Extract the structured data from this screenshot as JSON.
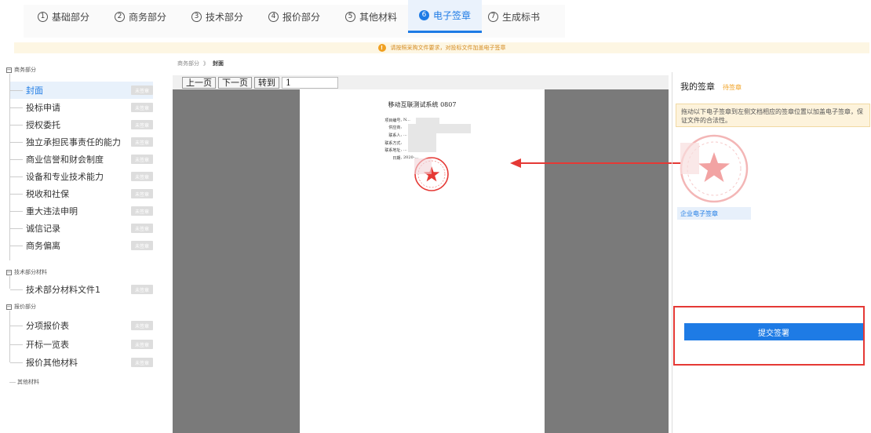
{
  "tabs": [
    {
      "num": "1",
      "label": "基础部分"
    },
    {
      "num": "2",
      "label": "商务部分"
    },
    {
      "num": "3",
      "label": "技术部分"
    },
    {
      "num": "4",
      "label": "报价部分"
    },
    {
      "num": "5",
      "label": "其他材料"
    },
    {
      "num": "6",
      "label": "电子签章",
      "active": true
    },
    {
      "num": "7",
      "label": "生成标书"
    }
  ],
  "notice": {
    "icon": "!",
    "text": "请按照采购文件要求，对投标文件加盖电子签章"
  },
  "sidebar": {
    "groups": [
      {
        "label": "商务部分"
      },
      {
        "label": "技术部分材料"
      },
      {
        "label": "报价部分"
      }
    ],
    "items": [
      {
        "label": "封面",
        "tag": "未签章"
      },
      {
        "label": "投标申请",
        "tag": "未签章"
      },
      {
        "label": "授权委托",
        "tag": "未签章"
      },
      {
        "label": "独立承担民事责任的能力",
        "tag": "未签章"
      },
      {
        "label": "商业信誉和财会制度",
        "tag": "未签章"
      },
      {
        "label": "设备和专业技术能力",
        "tag": "未签章"
      },
      {
        "label": "税收和社保",
        "tag": "未签章"
      },
      {
        "label": "重大违法申明",
        "tag": "未签章"
      },
      {
        "label": "诚信记录",
        "tag": "未签章"
      },
      {
        "label": "商务偏离",
        "tag": "未签章"
      },
      {
        "label": "技术部分材料文件1",
        "tag": "未签章"
      },
      {
        "label": "分项报价表",
        "tag": "未签章"
      },
      {
        "label": "开标一览表",
        "tag": "未签章"
      },
      {
        "label": "报价其他材料",
        "tag": "未签章"
      }
    ],
    "other": "其他材料"
  },
  "breadcrumb": {
    "parent": "商务部分",
    "sep": "》",
    "current": "封面"
  },
  "viewer": {
    "prev": "上一页",
    "next": "下一页",
    "goto": "转到",
    "page": "1",
    "doc_title": "移动互联测试系统 0807",
    "fields": [
      {
        "label": "项目编号:",
        "value": "N..."
      },
      {
        "label": "供应商:",
        "value": ""
      },
      {
        "label": "联系人:",
        "value": "..."
      },
      {
        "label": "联系方式:",
        "value": ""
      },
      {
        "label": "联系地址:",
        "value": "..."
      },
      {
        "label": "日期:",
        "value": "2020-..."
      }
    ]
  },
  "signature_panel": {
    "title": "我的签章",
    "status": "待签章",
    "tip": "拖动以下电子签章到左侧文档相应的签章位置以加盖电子签章，保证文件的合法性。",
    "stamp_label": "企业电子签章",
    "submit": "提交签署"
  },
  "colors": {
    "accent": "#1e7be5",
    "stamp": "#e53935",
    "highlight_box": "#e53935",
    "warning": "#f0a020"
  }
}
